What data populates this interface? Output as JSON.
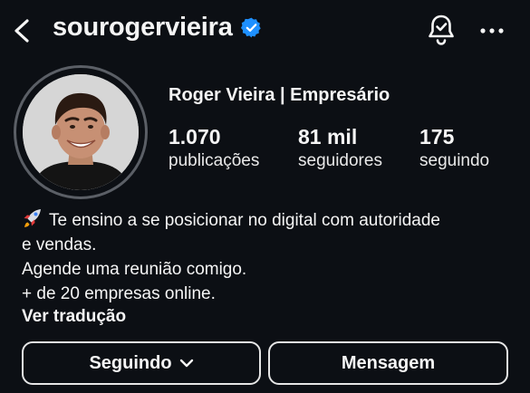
{
  "header": {
    "username": "sourogervieira",
    "verified": true,
    "icons": [
      "back-arrow-icon",
      "verified-badge-icon",
      "notification-bell-icon",
      "more-options-icon"
    ]
  },
  "profile": {
    "display_name": "Roger Vieira | Empresário",
    "stats": [
      {
        "value": "1.070",
        "label": "publicações"
      },
      {
        "value": "81 mil",
        "label": "seguidores"
      },
      {
        "value": "175",
        "label": "seguindo"
      }
    ]
  },
  "bio": {
    "emoji": "rocket-icon",
    "lines": [
      "Te ensino a se posicionar no digital com autoridade",
      "e vendas.",
      "Agende uma reunião comigo.",
      "+ de 20 empresas online."
    ],
    "translate_label": "Ver tradução"
  },
  "actions": {
    "following_label": "Seguindo",
    "message_label": "Mensagem"
  },
  "colors": {
    "background": "#0c0f14",
    "text": "#f5f5f5",
    "verified_blue": "#1e90ff",
    "border": "#e6e6e6"
  }
}
